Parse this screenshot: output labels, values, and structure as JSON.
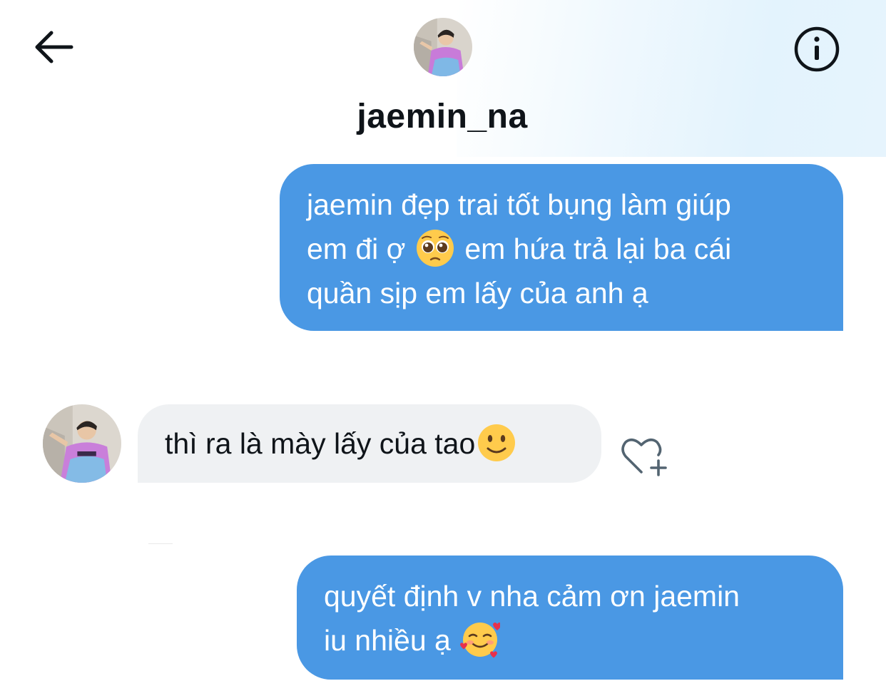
{
  "header": {
    "title": "jaemin_na",
    "back_icon": "arrow-left-icon",
    "info_icon": "info-icon",
    "avatar": "profile-avatar"
  },
  "messages": [
    {
      "direction": "outgoing",
      "lines": [
        {
          "text": "jaemin đẹp trai tốt bụng làm giúp"
        },
        {
          "before": "em đi ợ ",
          "emoji": "pleading-face-emoji",
          "after": "  em hứa trả lại  ba cái"
        },
        {
          "text": "quần sịp em lấy của anh ạ"
        }
      ]
    },
    {
      "direction": "incoming",
      "text": "thì ra là mày lấy của tao",
      "emoji": "slightly-smiling-face-emoji",
      "action_icon": "heart-plus-icon"
    },
    {
      "direction": "outgoing",
      "lines": [
        {
          "text": "quyết định v nha cảm ơn jaemin"
        },
        {
          "text": "iu nhiều ạ ",
          "emoji": "smiling-face-with-hearts-emoji"
        }
      ]
    }
  ],
  "colors": {
    "outgoing_bubble": "#4a98e4",
    "incoming_bubble": "#eff1f3",
    "text_dark": "#0f1419"
  }
}
